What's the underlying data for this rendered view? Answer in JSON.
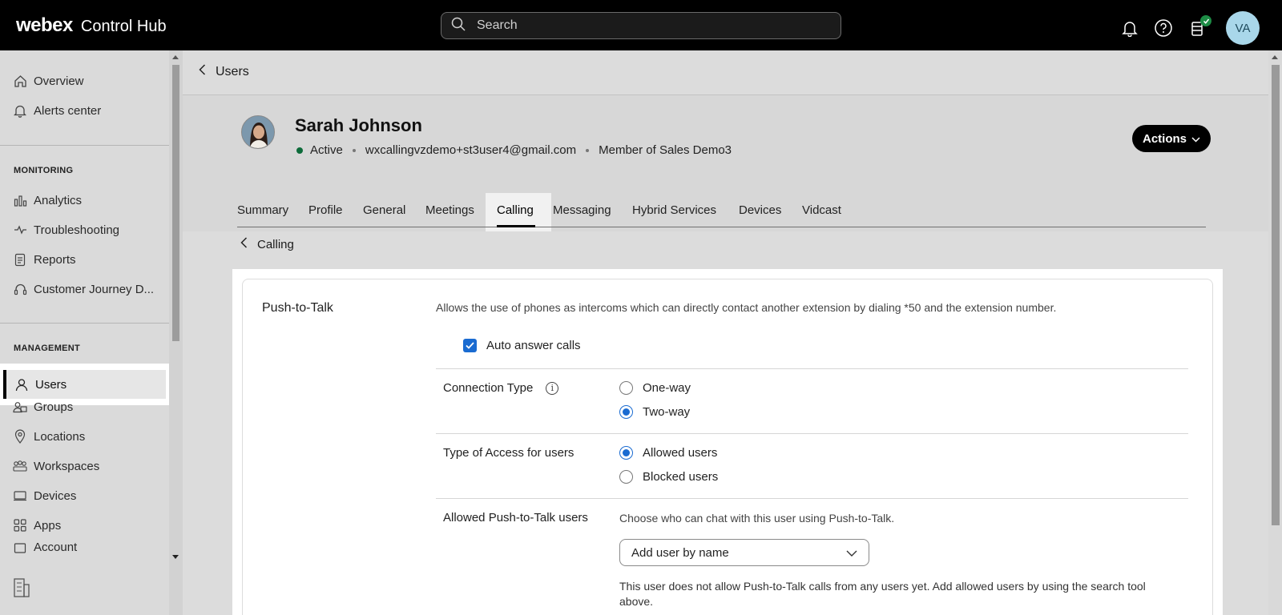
{
  "topbar": {
    "logo": "webex",
    "product": "Control Hub",
    "search_placeholder": "Search",
    "avatar_initials": "VA",
    "icons": [
      "bell-icon",
      "help-icon",
      "tasks-icon"
    ]
  },
  "sidebar": {
    "items_top": [
      {
        "label": "Overview",
        "icon": "home-icon"
      },
      {
        "label": "Alerts center",
        "icon": "bell-icon"
      }
    ],
    "monitoring_label": "MONITORING",
    "monitoring_items": [
      {
        "label": "Analytics",
        "icon": "analytics-icon"
      },
      {
        "label": "Troubleshooting",
        "icon": "pulse-icon"
      },
      {
        "label": "Reports",
        "icon": "reports-icon"
      },
      {
        "label": "Customer Journey D...",
        "icon": "headset-icon"
      }
    ],
    "management_label": "MANAGEMENT",
    "management_items": [
      {
        "label": "Users",
        "icon": "user-icon",
        "selected": true
      },
      {
        "label": "Groups",
        "icon": "group-icon"
      },
      {
        "label": "Locations",
        "icon": "location-icon"
      },
      {
        "label": "Workspaces",
        "icon": "workspaces-icon"
      },
      {
        "label": "Devices",
        "icon": "devices-icon"
      },
      {
        "label": "Apps",
        "icon": "apps-icon"
      },
      {
        "label": "Account",
        "icon": "account-icon"
      }
    ]
  },
  "breadcrumb": {
    "back_label": "Users"
  },
  "user": {
    "name": "Sarah Johnson",
    "status": "Active",
    "email": "wxcallingvzdemo+st3user4@gmail.com",
    "membership": "Member of Sales Demo3",
    "actions_label": "Actions"
  },
  "tabs": [
    "Summary",
    "Profile",
    "General",
    "Meetings",
    "Calling",
    "Messaging",
    "Hybrid Services",
    "Devices",
    "Vidcast"
  ],
  "active_tab": "Calling",
  "sub_breadcrumb": {
    "back_label": "Calling"
  },
  "ptt": {
    "title": "Push-to-Talk",
    "description": "Allows the use of phones as intercoms which can directly contact another extension by dialing *50 and the extension number.",
    "auto_answer_label": "Auto answer calls",
    "auto_answer_checked": true,
    "connection_type_label": "Connection Type",
    "connection_options": [
      {
        "label": "One-way",
        "selected": false
      },
      {
        "label": "Two-way",
        "selected": true
      }
    ],
    "access_type_label": "Type of Access for users",
    "access_options": [
      {
        "label": "Allowed users",
        "selected": true
      },
      {
        "label": "Blocked users",
        "selected": false
      }
    ],
    "allowed_users_label": "Allowed Push-to-Talk users",
    "choose_text": "Choose who can chat with this user using Push-to-Talk.",
    "dropdown_placeholder": "Add user by name",
    "note": "This user does not allow Push-to-Talk calls from any users yet. Add allowed users by using the search tool above."
  },
  "colors": {
    "accent": "#1a6bd1",
    "active_status": "#0d6b3a",
    "topbar_bg": "#000000",
    "avatar_bg": "#a9d7ea"
  }
}
